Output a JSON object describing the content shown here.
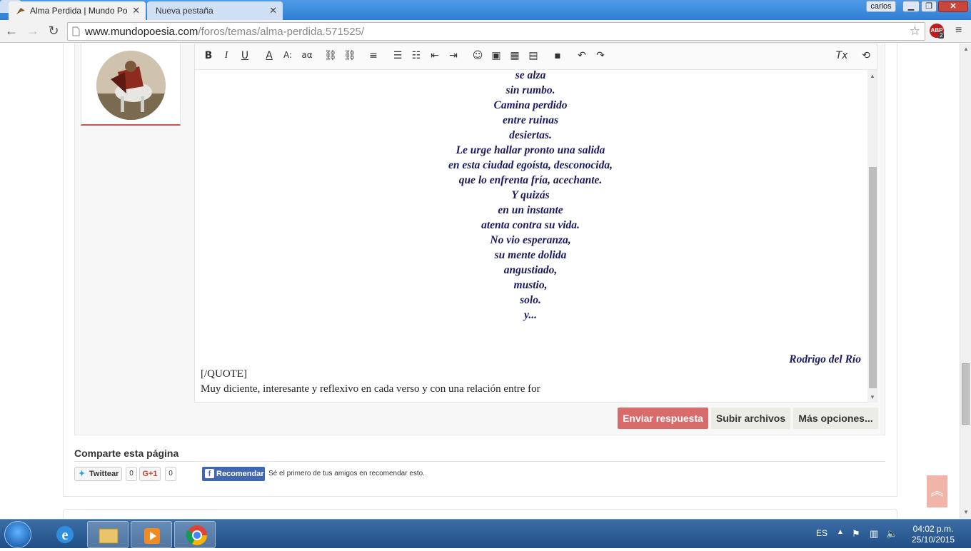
{
  "browser": {
    "tabs": [
      {
        "title": "Alma Perdida | Mundo Po",
        "active": true
      },
      {
        "title": "Nueva pestaña",
        "active": false
      }
    ],
    "user": "carlos",
    "url_domain": "www.mundopoesia.com",
    "url_path": "/foros/temas/alma-perdida.571525/",
    "abp_count": "2"
  },
  "editor": {
    "poem_lines": [
      "se alza",
      "sin rumbo.",
      "Camina perdido",
      "entre ruinas",
      "desiertas.",
      "Le urge hallar pronto una salida",
      "en esta ciudad egoísta, desconocida,",
      "que lo enfrenta fría, acechante.",
      "Y quizás",
      "en un instante",
      "atenta contra su vida.",
      "No vio esperanza,",
      "su mente dolida",
      "angustiado,",
      "mustio,",
      "solo.",
      "y..."
    ],
    "author": "Rodrigo del Río",
    "quote_close": "[/QUOTE]",
    "reply_text": "Muy diciente, interesante y reflexivo en cada verso y con una relación entre for"
  },
  "actions": {
    "send": "Enviar respuesta",
    "upload": "Subir archivos",
    "more": "Más opciones..."
  },
  "share": {
    "title": "Comparte esta página",
    "twitter_label": "Twittear",
    "twitter_count": "0",
    "gplus_label": "G+1",
    "gplus_count": "0",
    "fb_label": "Recomendar",
    "fb_text": "Sé el primero de tus amigos en recomendar esto."
  },
  "taskbar": {
    "lang": "ES",
    "time": "04:02 p.m.",
    "date": "25/10/2015"
  },
  "colors": {
    "poem": "#1a1a5e",
    "send_button": "#d96b6b",
    "accent_line": "#d45050"
  }
}
